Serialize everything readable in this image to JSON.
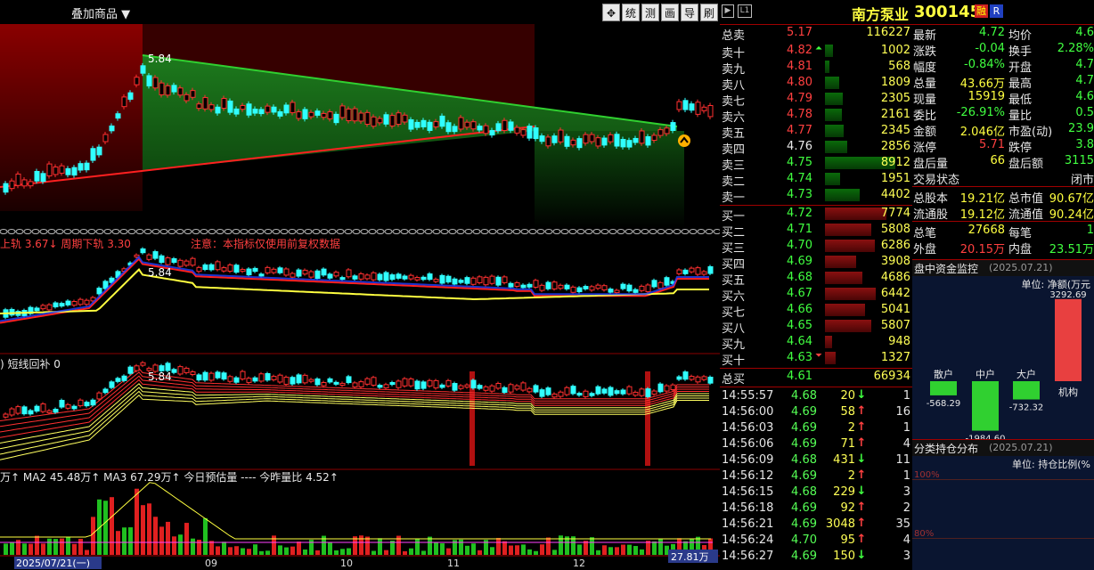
{
  "toolbar": {
    "overlay_label": "叠加商品",
    "overlay_arrow": "▼",
    "buttons": [
      "✥",
      "统",
      "测",
      "画",
      "导",
      "刷"
    ]
  },
  "indicators": {
    "top_price_label": "5.84",
    "band_text": "上轨 3.67↓ 周期下轨 3.30",
    "notice": "注意：本指标仅使用前复权数据",
    "line2_label": ") 短线回补 0",
    "ma_text": "万↑ MA2 45.48万↑ MA3 67.29万↑ 今日预估量 ---- 今昨量比 4.52↑"
  },
  "xaxis": {
    "date_box": "2025/07/21(一)",
    "labels": [
      "09",
      "10",
      "11",
      "12"
    ],
    "volume_box": "27.81万"
  },
  "header": {
    "stock_name": "南方泵业",
    "stock_code": "300145",
    "tag1": "融",
    "tag2": "R"
  },
  "order_book": {
    "total_sell": {
      "label": "总卖",
      "price": "5.17",
      "vol": "116227"
    },
    "asks": [
      {
        "label": "卖十",
        "price": "4.82",
        "vol": "1002",
        "color": "#ff4040",
        "up": true
      },
      {
        "label": "卖九",
        "price": "4.81",
        "vol": "568",
        "color": "#ff4040"
      },
      {
        "label": "卖八",
        "price": "4.80",
        "vol": "1809",
        "color": "#ff4040"
      },
      {
        "label": "卖七",
        "price": "4.79",
        "vol": "2305",
        "color": "#ff4040"
      },
      {
        "label": "卖六",
        "price": "4.78",
        "vol": "2161",
        "color": "#ff4040"
      },
      {
        "label": "卖五",
        "price": "4.77",
        "vol": "2345",
        "color": "#ff4040"
      },
      {
        "label": "卖四",
        "price": "4.76",
        "vol": "2856",
        "color": "#e8e8e8"
      },
      {
        "label": "卖三",
        "price": "4.75",
        "vol": "8912",
        "color": "#40ff40"
      },
      {
        "label": "卖二",
        "price": "4.74",
        "vol": "1951",
        "color": "#40ff40"
      },
      {
        "label": "卖一",
        "price": "4.73",
        "vol": "4402",
        "color": "#40ff40"
      }
    ],
    "bids": [
      {
        "label": "买一",
        "price": "4.72",
        "vol": "7774",
        "color": "#40ff40"
      },
      {
        "label": "买二",
        "price": "4.71",
        "vol": "5808",
        "color": "#40ff40"
      },
      {
        "label": "买三",
        "price": "4.70",
        "vol": "6286",
        "color": "#40ff40"
      },
      {
        "label": "买四",
        "price": "4.69",
        "vol": "3908",
        "color": "#40ff40"
      },
      {
        "label": "买五",
        "price": "4.68",
        "vol": "4686",
        "color": "#40ff40"
      },
      {
        "label": "买六",
        "price": "4.67",
        "vol": "6442",
        "color": "#40ff40"
      },
      {
        "label": "买七",
        "price": "4.66",
        "vol": "5041",
        "color": "#40ff40"
      },
      {
        "label": "买八",
        "price": "4.65",
        "vol": "5807",
        "color": "#40ff40"
      },
      {
        "label": "买九",
        "price": "4.64",
        "vol": "948",
        "color": "#40ff40"
      },
      {
        "label": "买十",
        "price": "4.63",
        "vol": "1327",
        "color": "#40ff40",
        "down": true
      }
    ],
    "total_buy": {
      "label": "总买",
      "price": "4.61",
      "vol": "66934"
    }
  },
  "ticks": [
    {
      "time": "14:55:57",
      "price": "4.68",
      "vol": "20",
      "dir": "down",
      "n": "1"
    },
    {
      "time": "14:56:00",
      "price": "4.69",
      "vol": "58",
      "dir": "up",
      "n": "16"
    },
    {
      "time": "14:56:03",
      "price": "4.69",
      "vol": "2",
      "dir": "up",
      "n": "1"
    },
    {
      "time": "14:56:06",
      "price": "4.69",
      "vol": "71",
      "dir": "up",
      "n": "4"
    },
    {
      "time": "14:56:09",
      "price": "4.68",
      "vol": "431",
      "dir": "down",
      "n": "11"
    },
    {
      "time": "14:56:12",
      "price": "4.69",
      "vol": "2",
      "dir": "up",
      "n": "1"
    },
    {
      "time": "14:56:15",
      "price": "4.68",
      "vol": "229",
      "dir": "down",
      "n": "3"
    },
    {
      "time": "14:56:18",
      "price": "4.69",
      "vol": "92",
      "dir": "up",
      "n": "2"
    },
    {
      "time": "14:56:21",
      "price": "4.69",
      "vol": "3048",
      "dir": "up",
      "n": "35"
    },
    {
      "time": "14:56:24",
      "price": "4.70",
      "vol": "95",
      "dir": "up",
      "n": "4"
    },
    {
      "time": "14:56:27",
      "price": "4.69",
      "vol": "150",
      "dir": "down",
      "n": "3"
    }
  ],
  "stats": [
    {
      "l1": "最新",
      "v1": "4.72",
      "c1": "#40ff40",
      "l2": "均价",
      "v2": "4.6"
    },
    {
      "l1": "涨跌",
      "v1": "-0.04",
      "c1": "#40ff40",
      "l2": "换手",
      "v2": "2.28%"
    },
    {
      "l1": "幅度",
      "v1": "-0.84%",
      "c1": "#40ff40",
      "l2": "开盘",
      "v2": "4.7"
    },
    {
      "l1": "总量",
      "v1": "43.66万",
      "c1": "#ffff40",
      "l2": "最高",
      "v2": "4.7"
    },
    {
      "l1": "现量",
      "v1": "15919",
      "c1": "#ffff40",
      "l2": "最低",
      "v2": "4.6"
    },
    {
      "l1": "委比",
      "v1": "-26.91%",
      "c1": "#40ff40",
      "l2": "量比",
      "v2": "0.5"
    },
    {
      "l1": "金额",
      "v1": "2.046亿",
      "c1": "#ffff40",
      "l2": "市盈(动)",
      "v2": "23.9"
    },
    {
      "l1": "涨停",
      "v1": "5.71",
      "c1": "#ff4040",
      "l2": "跌停",
      "v2": "3.8"
    },
    {
      "l1": "盘后量",
      "v1": "66",
      "c1": "#ffff40",
      "l2": "盘后额",
      "v2": "3115"
    },
    {
      "l1": "交易状态",
      "v1": "",
      "c1": "#e8e8e8",
      "l2": "",
      "v2": "闭市"
    }
  ],
  "capital": [
    {
      "l1": "总股本",
      "v1": "19.21亿",
      "l2": "总市值",
      "v2": "90.67亿"
    },
    {
      "l1": "流通股",
      "v1": "19.12亿",
      "l2": "流通值",
      "v2": "90.24亿"
    }
  ],
  "trade_summary": [
    {
      "l1": "总笔",
      "v1": "27668",
      "c1": "#ffff40",
      "l2": "每笔",
      "v2": "1"
    },
    {
      "l1": "外盘",
      "v1": "20.15万",
      "c1": "#ff4040",
      "l2": "内盘",
      "v2": "23.51万"
    }
  ],
  "fund_monitor": {
    "title": "盘中资金监控",
    "date": "(2025.07.21)",
    "unit": "单位: 净额(万元",
    "categories": [
      "散户",
      "中户",
      "大户",
      "机构"
    ],
    "values": [
      -568.29,
      -1984.6,
      -732.32,
      3292.69
    ],
    "value_labels": [
      "-568.29",
      "-1984.60",
      "-732.32",
      "3292.69"
    ]
  },
  "holding": {
    "title": "分类持仓分布",
    "date": "(2025.07.21)",
    "unit": "单位: 持仓比例(%",
    "pct100": "100%",
    "pct80": "80%"
  }
}
